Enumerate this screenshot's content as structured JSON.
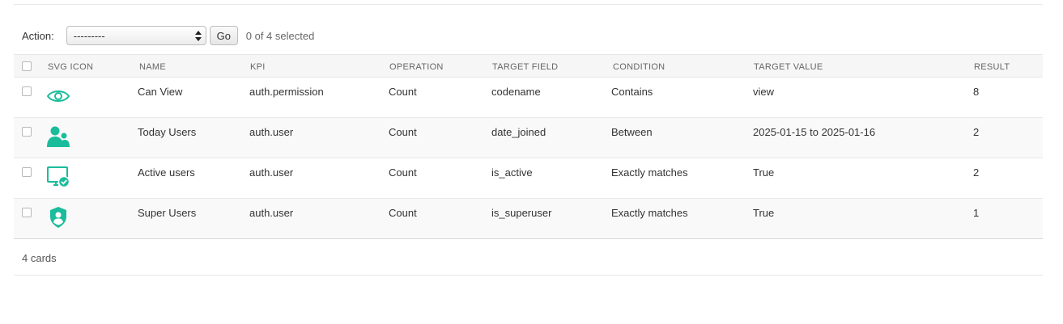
{
  "actions": {
    "label": "Action:",
    "select_value": "---------",
    "go_label": "Go",
    "selected_text": "0 of 4 selected"
  },
  "columns": [
    "SVG ICON",
    "NAME",
    "KPI",
    "OPERATION",
    "TARGET FIELD",
    "CONDITION",
    "TARGET VALUE",
    "RESULT"
  ],
  "rows": [
    {
      "icon": "eye-icon",
      "name": "Can View",
      "kpi": "auth.permission",
      "operation": "Count",
      "target_field": "codename",
      "condition": "Contains",
      "target_value": "view",
      "result": "8"
    },
    {
      "icon": "users-icon",
      "name": "Today Users",
      "kpi": "auth.user",
      "operation": "Count",
      "target_field": "date_joined",
      "condition": "Between",
      "target_value": "2025-01-15 to 2025-01-16",
      "result": "2"
    },
    {
      "icon": "monitor-check-icon",
      "name": "Active users",
      "kpi": "auth.user",
      "operation": "Count",
      "target_field": "is_active",
      "condition": "Exactly matches",
      "target_value": "True",
      "result": "2"
    },
    {
      "icon": "shield-user-icon",
      "name": "Super Users",
      "kpi": "auth.user",
      "operation": "Count",
      "target_field": "is_superuser",
      "condition": "Exactly matches",
      "target_value": "True",
      "result": "1"
    }
  ],
  "footer": {
    "count_text": "4 cards"
  },
  "colors": {
    "icon_accent": "#1bbc9b"
  }
}
